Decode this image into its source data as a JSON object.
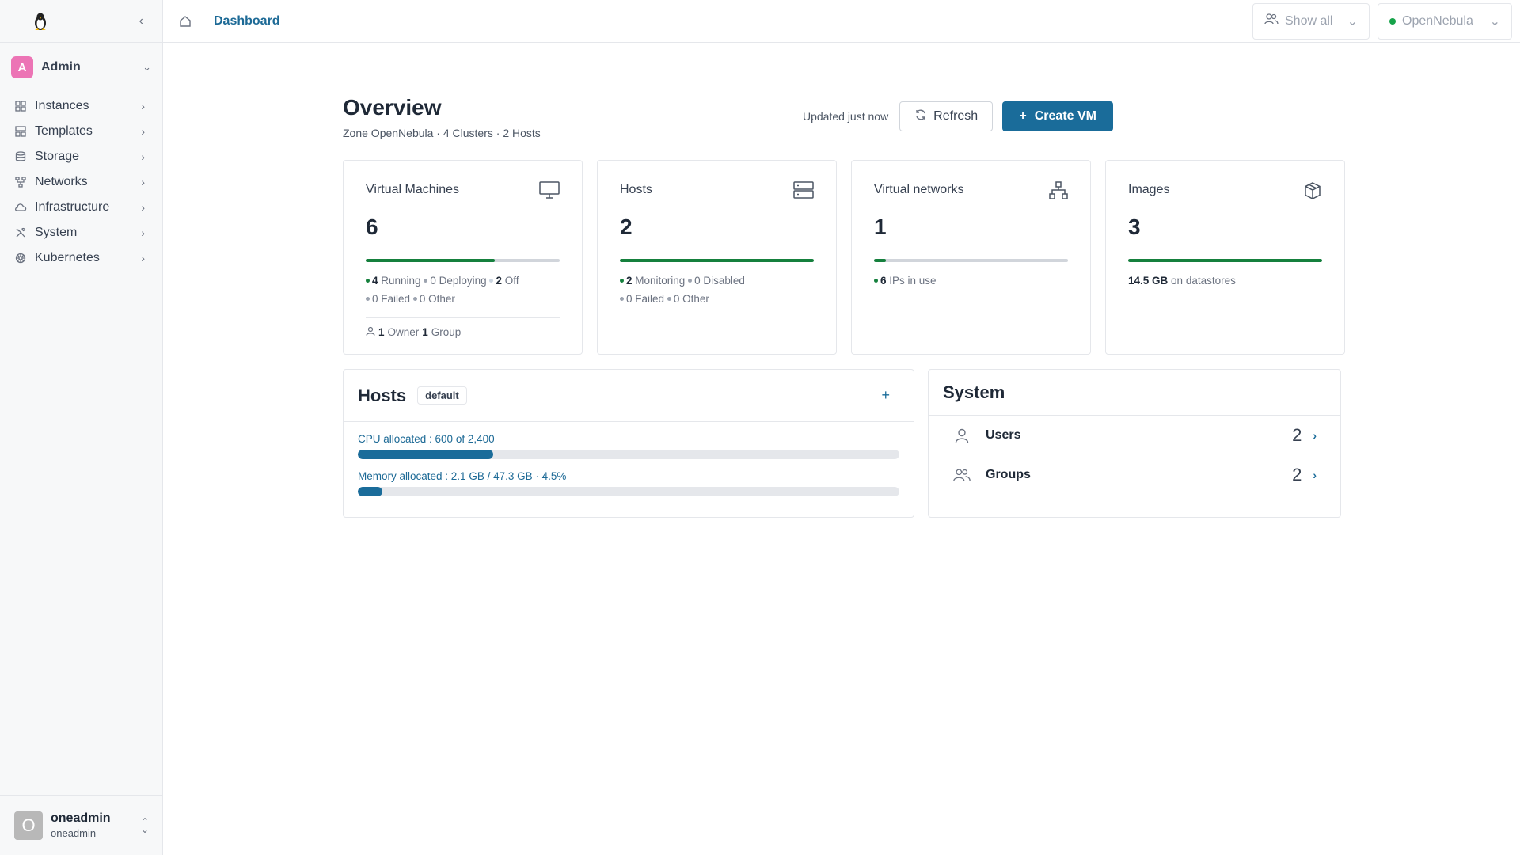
{
  "sidebar": {
    "logo_icon": "penguin-icon",
    "account": {
      "initial": "A",
      "name": "Admin",
      "color": "#ec74b5"
    },
    "items": [
      {
        "label": "Instances",
        "icon": "grid-icon"
      },
      {
        "label": "Templates",
        "icon": "layout-icon"
      },
      {
        "label": "Storage",
        "icon": "database-icon"
      },
      {
        "label": "Networks",
        "icon": "network-icon"
      },
      {
        "label": "Infrastructure",
        "icon": "cloud-icon"
      },
      {
        "label": "System",
        "icon": "tools-icon"
      },
      {
        "label": "Kubernetes",
        "icon": "helm-icon"
      }
    ],
    "user": {
      "initial": "O",
      "name": "oneadmin",
      "sub": "oneadmin"
    }
  },
  "topbar": {
    "breadcrumb": "Dashboard",
    "filter": "Show all",
    "zone": "OpenNebula"
  },
  "overview": {
    "title": "Overview",
    "subtitle": "Zone OpenNebula · 4 Clusters · 2 Hosts",
    "updated": "Updated just now",
    "refresh_label": "Refresh",
    "create_label": "Create VM"
  },
  "cards": {
    "vms": {
      "title": "Virtual Machines",
      "count": "6",
      "running": "4",
      "running_label": "Running",
      "deploying": "0",
      "deploying_label": "Deploying",
      "off": "2",
      "off_label": "Off",
      "failed": "0",
      "failed_label": "Failed",
      "other": "0",
      "other_label": "Other",
      "owner_count": "1",
      "owner_label": "Owner",
      "group_count": "1",
      "group_label": "Group",
      "progress": 0.667
    },
    "hosts": {
      "title": "Hosts",
      "count": "2",
      "monitoring": "2",
      "monitoring_label": "Monitoring",
      "disabled": "0",
      "disabled_label": "Disabled",
      "failed": "0",
      "failed_label": "Failed",
      "other": "0",
      "other_label": "Other",
      "progress": 1.0
    },
    "networks": {
      "title": "Virtual networks",
      "count": "1",
      "ips": "6",
      "ips_label": "IPs in use",
      "progress": 0.06
    },
    "images": {
      "title": "Images",
      "count": "3",
      "size": "14.5 GB",
      "size_label": "on datastores",
      "progress": 1.0
    }
  },
  "hosts_panel": {
    "title": "Hosts",
    "tag": "default",
    "cpu_label": "CPU allocated : 600 of 2,400",
    "cpu_fraction": 0.25,
    "mem_label": "Memory allocated : 2.1 GB / 47.3 GB · 4.5%",
    "mem_fraction": 0.045
  },
  "system_panel": {
    "title": "System",
    "users_label": "Users",
    "users_count": "2",
    "groups_label": "Groups",
    "groups_count": "2"
  },
  "colors": {
    "accent": "#1a6c9a",
    "success": "#15803d"
  }
}
